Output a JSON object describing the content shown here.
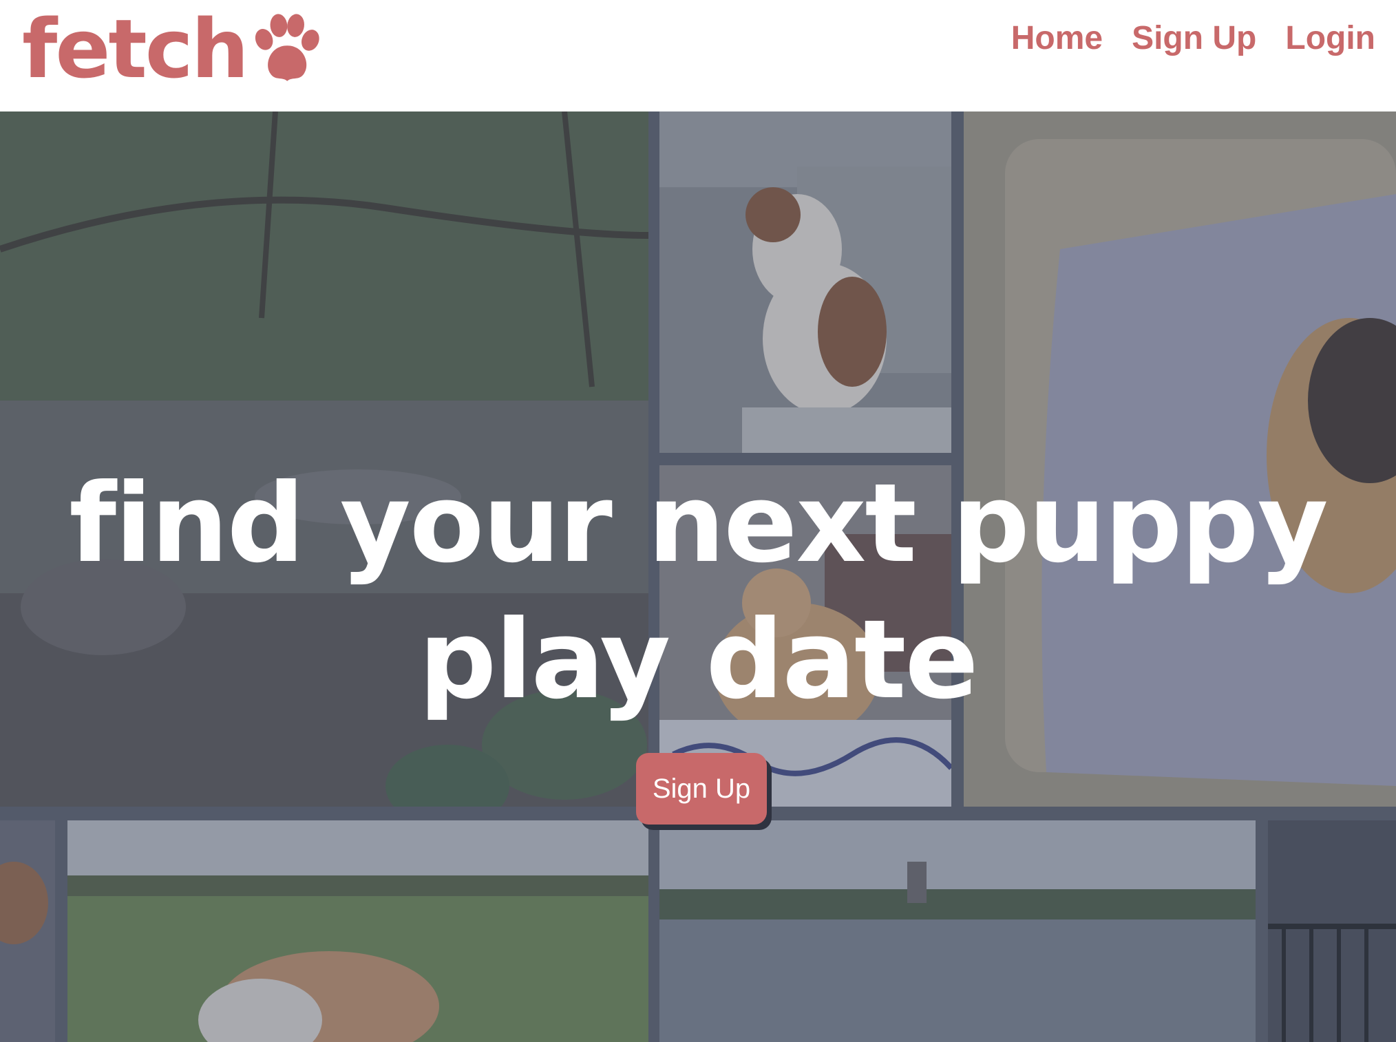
{
  "brand": {
    "name": "fetch",
    "accent_color": "#c8696a",
    "logo_icon": "paw-icon"
  },
  "nav": {
    "items": [
      {
        "label": "Home"
      },
      {
        "label": "Sign Up"
      },
      {
        "label": "Login"
      }
    ]
  },
  "hero": {
    "headline_line1": "find your next puppy",
    "headline_line2": "play date",
    "cta_label": "Sign Up",
    "photos": [
      "creek-photo",
      "dog-in-car-photo",
      "pug-on-blanket-photo",
      "dog-on-couch-photo",
      "dogs-playing-park-photo",
      "lake-photo",
      "brown-dog-photo",
      "fence-photo"
    ]
  }
}
